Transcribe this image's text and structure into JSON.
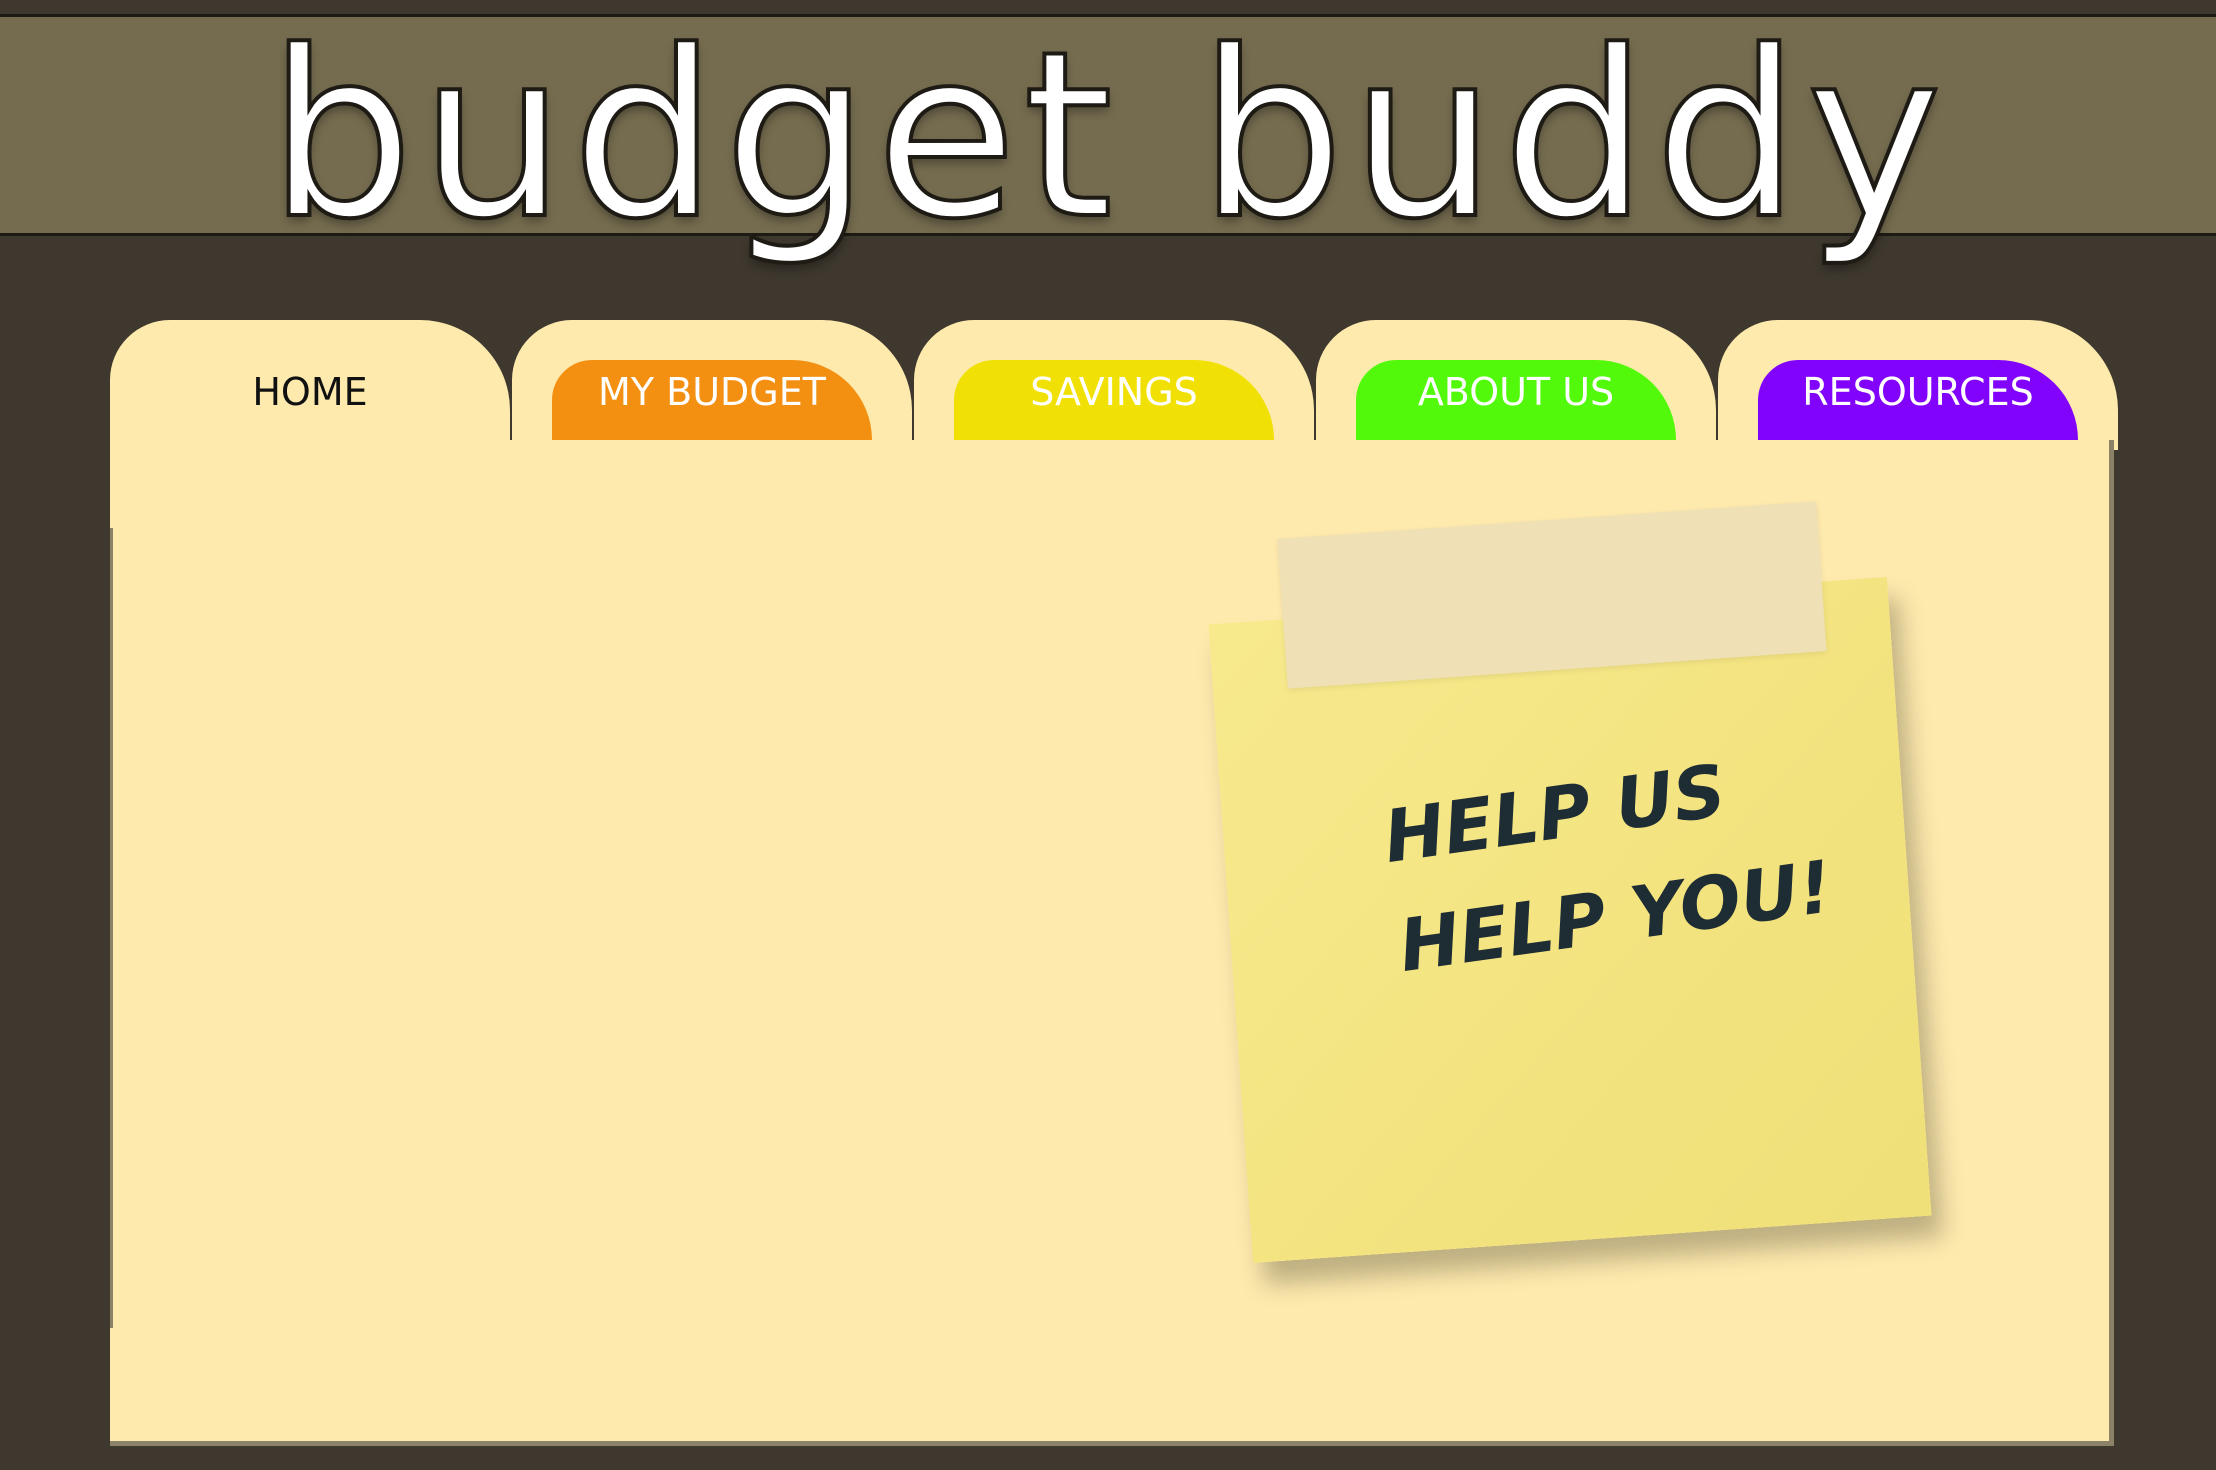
{
  "app": {
    "title": "budget buddy"
  },
  "tabs": [
    {
      "label": "HOME",
      "active": true
    },
    {
      "label": "MY BUDGET",
      "color": "#f39012"
    },
    {
      "label": "SAVINGS",
      "color": "#f1e004"
    },
    {
      "label": "ABOUT US",
      "color": "#52f90a"
    },
    {
      "label": "RESOURCES",
      "color": "#8203fb"
    }
  ],
  "sticky_note": {
    "line1": "HELP US",
    "line2": "HELP YOU!"
  },
  "colors": {
    "header": "#756c4f",
    "background": "#3e382e",
    "folder": "#feeaad",
    "note": "#f5e77f"
  }
}
